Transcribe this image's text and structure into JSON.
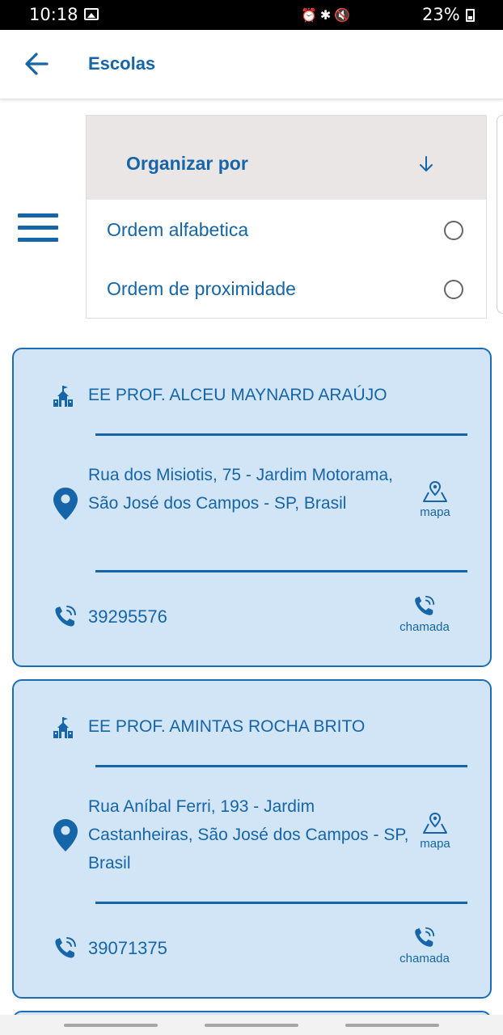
{
  "status_bar": {
    "time": "10:18",
    "icons_text": "⏰✱🔇",
    "battery": "23%"
  },
  "app_bar": {
    "title": "Escolas",
    "back_icon": "arrow-left-icon"
  },
  "sort_panel": {
    "title": "Organizar por",
    "options": [
      {
        "label": "Ordem alfabetica",
        "selected": false
      },
      {
        "label": "Ordem de proximidade",
        "selected": false
      }
    ]
  },
  "schools": [
    {
      "name": "EE PROF. ALCEU MAYNARD ARAÚJO",
      "address": "Rua dos Misiotis, 75 - Jardim Motorama, São José dos Campos - SP, Brasil",
      "map_label": "mapa",
      "phone": "39295576",
      "call_label": "chamada"
    },
    {
      "name": "EE PROF. AMINTAS ROCHA BRITO",
      "address": "Rua Aníbal Ferri, 193 - Jardim Castanheiras, São José dos Campos - SP, Brasil",
      "map_label": "mapa",
      "phone": "39071375",
      "call_label": "chamada"
    }
  ],
  "colors": {
    "accent": "#1565a8",
    "card_background": "#d2e5f7",
    "card_border": "#1d6db5",
    "sort_header_background": "#ebe6e6"
  }
}
